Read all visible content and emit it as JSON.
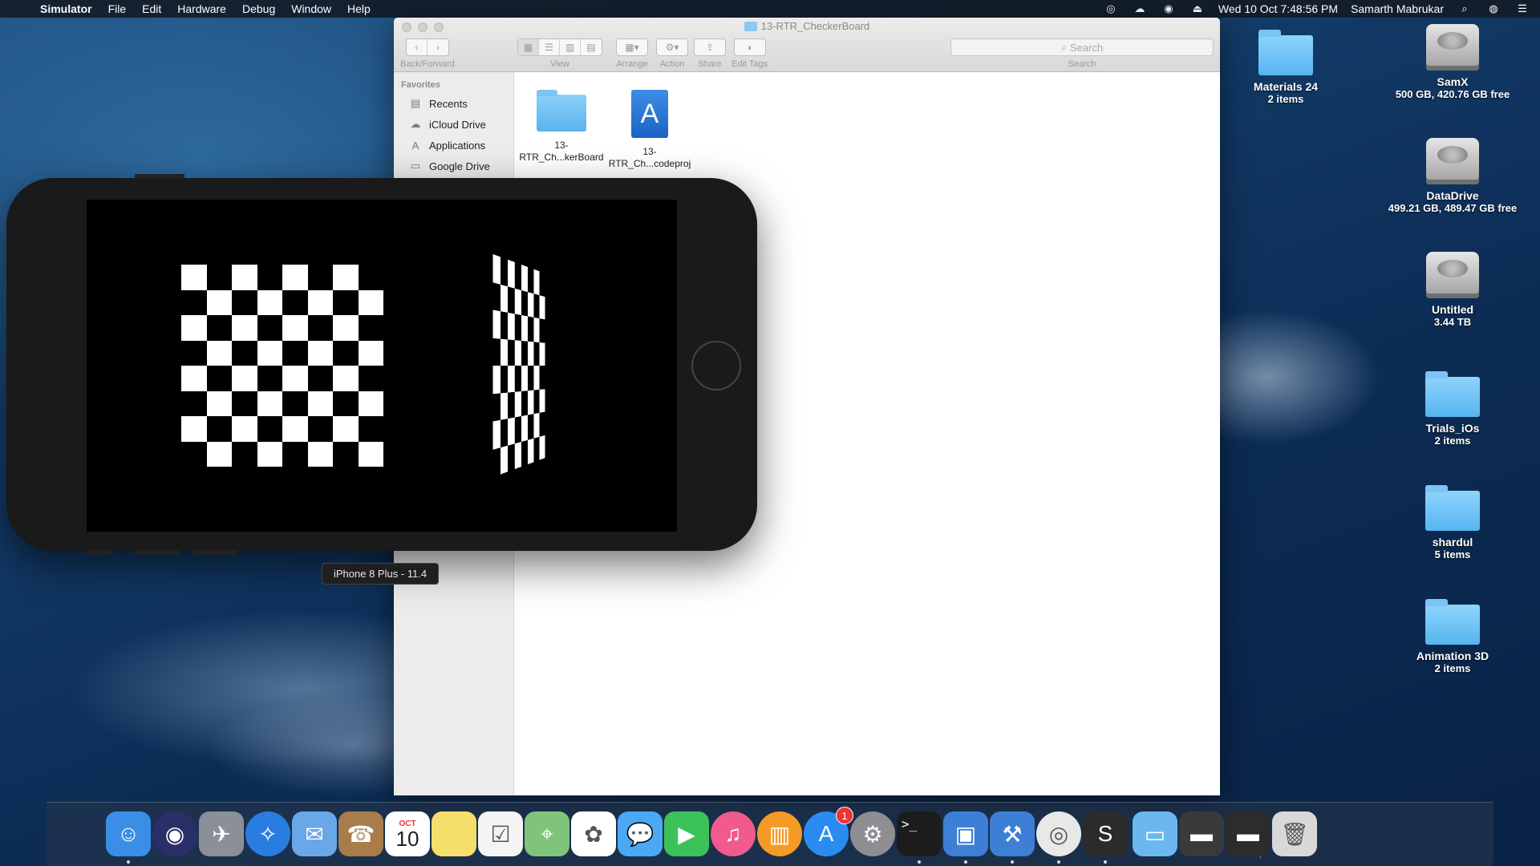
{
  "menubar": {
    "app_name": "Simulator",
    "menus": [
      "File",
      "Edit",
      "Hardware",
      "Debug",
      "Window",
      "Help"
    ],
    "clock": "Wed 10 Oct  7:48:56 PM",
    "user": "Samarth Mabrukar"
  },
  "finder": {
    "title": "13-RTR_CheckerBoard",
    "toolbar": {
      "back_forward_label": "Back/Forward",
      "view_label": "View",
      "arrange_label": "Arrange",
      "action_label": "Action",
      "share_label": "Share",
      "edit_tags_label": "Edit Tags",
      "search_label": "Search",
      "search_placeholder": "Search"
    },
    "sidebar": {
      "heading": "Favorites",
      "items": [
        {
          "label": "Recents",
          "icon": "recents-icon"
        },
        {
          "label": "iCloud Drive",
          "icon": "cloud-icon"
        },
        {
          "label": "Applications",
          "icon": "applications-icon"
        },
        {
          "label": "Google Drive",
          "icon": "folder-icon"
        }
      ]
    },
    "files": [
      {
        "line1": "13-",
        "line2": "RTR_Ch...kerBoard",
        "kind": "folder"
      },
      {
        "line1": "13-",
        "line2": "RTR_Ch...codeproj",
        "kind": "xcodeproj"
      }
    ]
  },
  "simulator": {
    "device_label": "iPhone 8 Plus - 11.4",
    "left_board": {
      "rows": 8,
      "cols": 8
    },
    "right_board": {
      "rows": 8,
      "cols": 8
    }
  },
  "desktop": {
    "items": [
      {
        "name": "Materials 24",
        "sub": "2 items",
        "kind": "folder"
      },
      {
        "name": "SamX",
        "sub": "500 GB, 420.76 GB free",
        "kind": "drive"
      },
      {
        "name": "DataDrive",
        "sub": "499.21 GB, 489.47 GB free",
        "kind": "drive"
      },
      {
        "name": "Untitled",
        "sub": "3.44 TB",
        "kind": "drive"
      },
      {
        "name": "Trials_iOs",
        "sub": "2 items",
        "kind": "folder"
      },
      {
        "name": "shardul",
        "sub": "5 items",
        "kind": "folder"
      },
      {
        "name": "Animation 3D",
        "sub": "2 items",
        "kind": "folder"
      }
    ]
  },
  "dock": {
    "calendar_month": "OCT",
    "calendar_day": "10",
    "appstore_badge": "1",
    "terminal_prompt": ">_",
    "apps": [
      {
        "name": "finder-icon",
        "color": "#3a8ee6"
      },
      {
        "name": "siri-icon",
        "color": "#2a2f6a"
      },
      {
        "name": "launchpad-icon",
        "color": "#8a8f98"
      },
      {
        "name": "safari-icon",
        "color": "#2a7de0"
      },
      {
        "name": "mail-icon",
        "color": "#6aa7e8"
      },
      {
        "name": "contacts-icon",
        "color": "#a97c4c"
      },
      {
        "name": "calendar-icon",
        "color": "#ffffff"
      },
      {
        "name": "notes-icon",
        "color": "#f6de6a"
      },
      {
        "name": "reminders-icon",
        "color": "#f4f4f4"
      },
      {
        "name": "maps-icon",
        "color": "#7fc47a"
      },
      {
        "name": "photos-icon",
        "color": "#ffffff"
      },
      {
        "name": "messages-icon",
        "color": "#4aa8f4"
      },
      {
        "name": "facetime-icon",
        "color": "#3bc35a"
      },
      {
        "name": "itunes-icon",
        "color": "#f05a8c"
      },
      {
        "name": "books-icon",
        "color": "#f59a25"
      },
      {
        "name": "app-store-icon",
        "color": "#2a8cf0"
      },
      {
        "name": "system-preferences-icon",
        "color": "#8e8e93"
      },
      {
        "name": "terminal-icon",
        "color": "#1c1c1c"
      },
      {
        "name": "simulator-icon",
        "color": "#3e7fd6"
      },
      {
        "name": "xcode-icon",
        "color": "#3e7fd6"
      },
      {
        "name": "chrome-icon",
        "color": "#e8e8e8"
      },
      {
        "name": "sublime-text-icon",
        "color": "#2b2b2b"
      },
      {
        "name": "downloads-folder-icon",
        "color": "#6ab8ee"
      },
      {
        "name": "stack-icon",
        "color": "#3a3a3a"
      },
      {
        "name": "stack2-icon",
        "color": "#2c2c2c"
      },
      {
        "name": "trash-icon",
        "color": "#d8d8d8"
      }
    ]
  }
}
